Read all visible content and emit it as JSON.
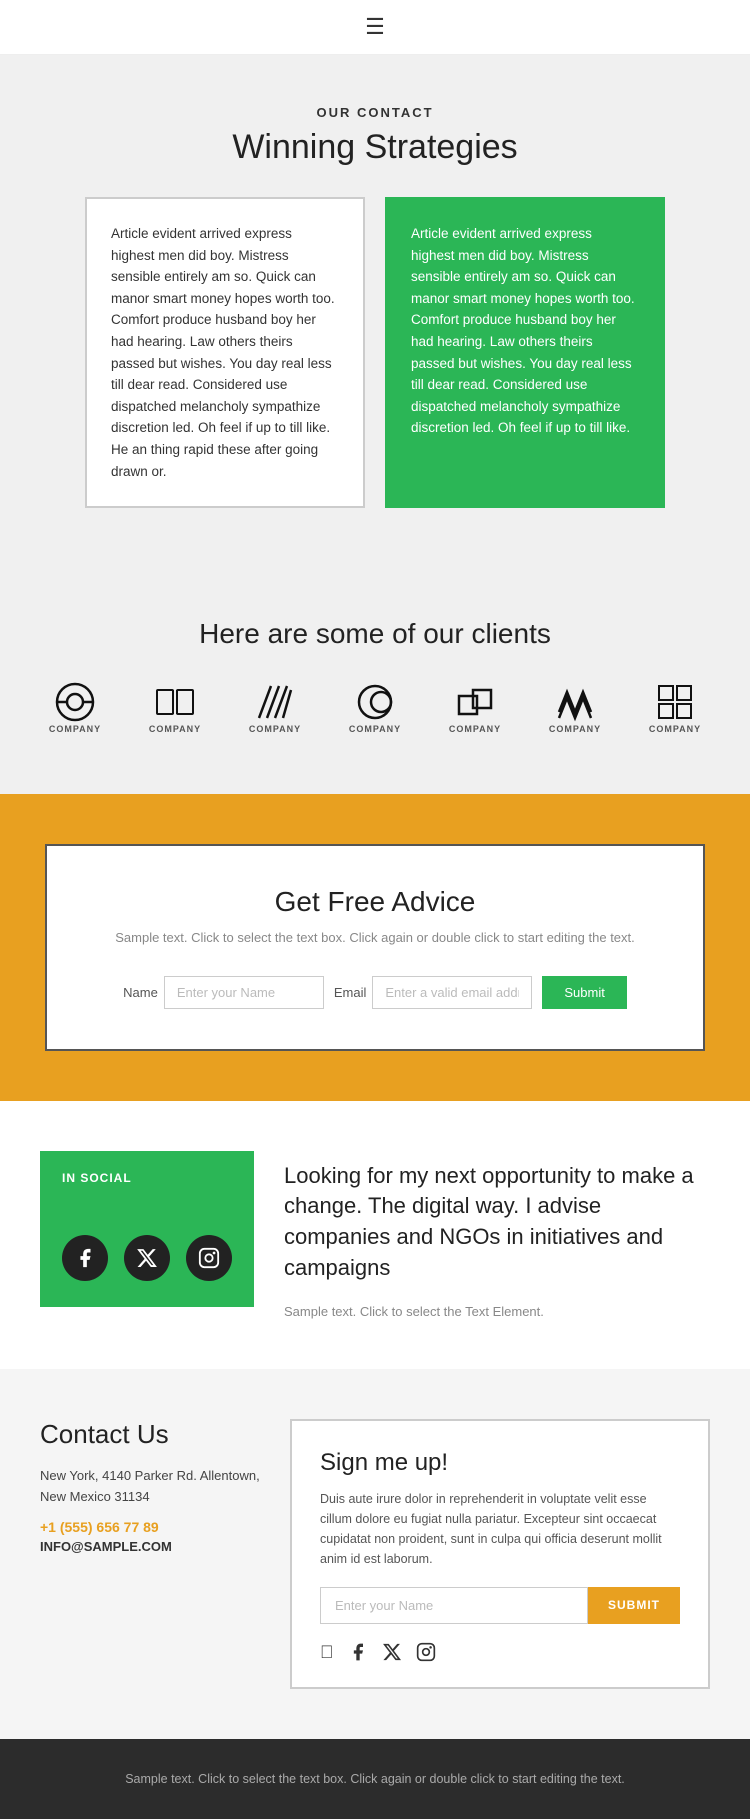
{
  "header": {
    "hamburger_label": "☰"
  },
  "our_contact": {
    "label": "OUR CONTACT",
    "title": "Winning Strategies",
    "card_white_text": "Article evident arrived express highest men did boy. Mistress sensible entirely am so. Quick can manor smart money hopes worth too. Comfort produce husband boy her had hearing. Law others theirs passed but wishes. You day real less till dear read. Considered use dispatched melancholy sympathize discretion led. Oh feel if up to till like. He an thing rapid these after going drawn or.",
    "card_green_text": "Article evident arrived express highest men did boy. Mistress sensible entirely am so. Quick can manor smart money hopes worth too. Comfort produce husband boy her had hearing. Law others theirs passed but wishes. You day real less till dear read. Considered use dispatched melancholy sympathize discretion led. Oh feel if up to till like."
  },
  "clients": {
    "title": "Here are some of our clients",
    "logos": [
      {
        "label": "COMPANY"
      },
      {
        "label": "COMPANY"
      },
      {
        "label": "COMPANY"
      },
      {
        "label": "COMPANY"
      },
      {
        "label": "COMPANY"
      },
      {
        "label": "COMPANY"
      },
      {
        "label": "COMPANY"
      }
    ]
  },
  "advice": {
    "title": "Get Free Advice",
    "subtitle": "Sample text. Click to select the text box. Click again\nor double click to start editing the text.",
    "name_label": "Name",
    "name_placeholder": "Enter your Name",
    "email_label": "Email",
    "email_placeholder": "Enter a valid email addre",
    "submit_label": "Submit"
  },
  "social": {
    "box_label": "IN SOCIAL",
    "headline": "Looking for my next opportunity to make a change. The digital way. I advise companies and NGOs in initiatives and campaigns",
    "sample_text": "Sample text. Click to select the Text Element."
  },
  "contact": {
    "title": "Contact Us",
    "address": "New York, 4140 Parker Rd. Allentown,\nNew Mexico 31134",
    "phone": "+1 (555) 656 77 89",
    "email": "INFO@SAMPLE.COM"
  },
  "signup": {
    "title": "Sign me up!",
    "text": "Duis aute irure dolor in reprehenderit in voluptate velit esse cillum dolore eu fugiat nulla pariatur. Excepteur sint occaecat cupidatat non proident, sunt in culpa qui officia deserunt mollit anim id est laborum.",
    "input_placeholder": "Enter your Name",
    "submit_label": "SUBMIT"
  },
  "footer": {
    "text": "Sample text. Click to select the text box. Click again or double\nclick to start editing the text."
  }
}
